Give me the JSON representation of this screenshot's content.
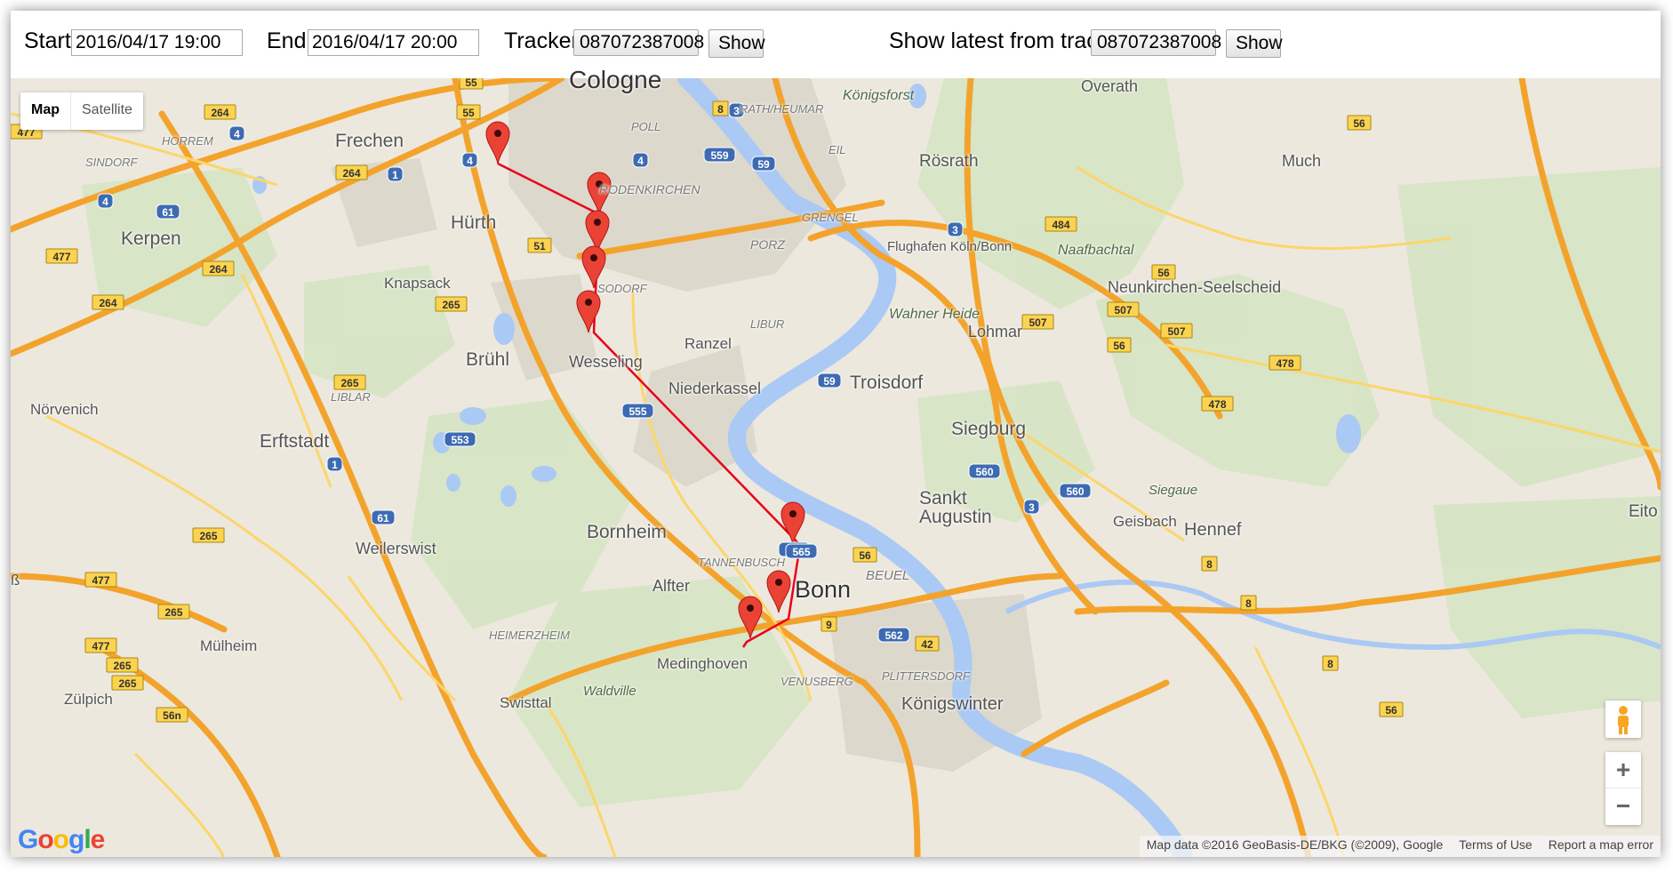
{
  "toolbar": {
    "start_label": "Start:",
    "start_value": "2016/04/17 19:00",
    "end_label": "End:",
    "end_value": "2016/04/17 20:00",
    "tracker_label": "Tracker:",
    "tracker_value": "087072387008",
    "show_label": "Show",
    "latest_label": "Show latest from tracker:",
    "latest_value": "087072387008",
    "latest_show_label": "Show"
  },
  "map": {
    "type_buttons": [
      "Map",
      "Satellite"
    ],
    "active_type": "Map",
    "zoom_in": "+",
    "zoom_out": "−",
    "logo": "Google",
    "attribution": "Map data ©2016 GeoBasis-DE/BKG (©2009), Google",
    "terms": "Terms of Use",
    "report": "Report a map error",
    "route_color": "#e8001c",
    "marker_color": "#ea4335",
    "road_color": "#f3a32c",
    "river_color": "#aac9f4",
    "markers": [
      {
        "lat": "marker-1"
      },
      {
        "lat": "marker-2"
      },
      {
        "lat": "marker-3"
      },
      {
        "lat": "marker-4"
      },
      {
        "lat": "marker-5"
      },
      {
        "lat": "marker-6"
      },
      {
        "lat": "marker-7"
      },
      {
        "lat": "marker-8"
      }
    ],
    "places": {
      "cologne": "Cologne",
      "frechen": "Frechen",
      "huerth": "Hürth",
      "kerpen": "Kerpen",
      "knapsack": "Knapsack",
      "bruehl": "Brühl",
      "wesseling": "Wesseling",
      "niederkassel": "Niederkassel",
      "ranzel": "Ranzel",
      "troisdorf": "Troisdorf",
      "siegburg": "Siegburg",
      "sankt_augustin": "Sankt\nAugustin",
      "bonn": "Bonn",
      "alfter": "Alfter",
      "bornheim": "Bornheim",
      "erftstadt": "Erftstadt",
      "weilerswist": "Weilerswist",
      "noervenich": "Nörvenich",
      "muelheim": "Mülheim",
      "zuelpich": "Zülpich",
      "swisttal": "Swisttal",
      "medinghoven": "Medinghoven",
      "koenigswinter": "Königswinter",
      "hennef": "Hennef",
      "geisbach": "Geisbach",
      "roesrath": "Rösrath",
      "overath": "Overath",
      "much": "Much",
      "lohmar": "Lohmar",
      "neunkirchen": "Neunkirchen-Seelscheid",
      "flughafen": "Flughafen Köln/Bonn",
      "koenigsforst": "Königsforst",
      "wahner_heide": "Wahner Heide",
      "naafbachtal": "Naafbachtal",
      "siegaue": "Siegaue",
      "waldville": "Waldville",
      "eitorf": "Eito",
      "porz": "PORZ",
      "libur": "LIBUR",
      "grengel": "GRENGEL",
      "eil": "EIL",
      "poll": "POLL",
      "rath": "RATH/HEUMAR",
      "rodenkirchen": "RODENKIRCHEN",
      "sindorf": "SINDORF",
      "horrem": "HORREM",
      "liblar": "LIBLAR",
      "tannenbusch": "TANNENBUSCH",
      "beuel": "BEUEL",
      "heimerzheim": "HEIMERZHEIM",
      "venusberg": "VENUSBERG",
      "plittersdorf": "PLITTERSDORF",
      "sodorf": "SODORF",
      "cologne_partial": "ß"
    },
    "shields": [
      "55",
      "264",
      "477",
      "55",
      "4",
      "4",
      "1",
      "264",
      "61",
      "4",
      "477",
      "264",
      "264",
      "265",
      "51",
      "265",
      "265",
      "553",
      "1",
      "61",
      "265",
      "477",
      "265",
      "477",
      "265",
      "56n",
      "8",
      "3",
      "559",
      "59",
      "4",
      "565",
      "3",
      "484",
      "56",
      "507",
      "507",
      "507",
      "56",
      "478",
      "478",
      "8",
      "8",
      "59",
      "555",
      "560",
      "560",
      "3",
      "565",
      "56",
      "9",
      "562",
      "42",
      "56",
      "8",
      "8",
      "56"
    ]
  }
}
